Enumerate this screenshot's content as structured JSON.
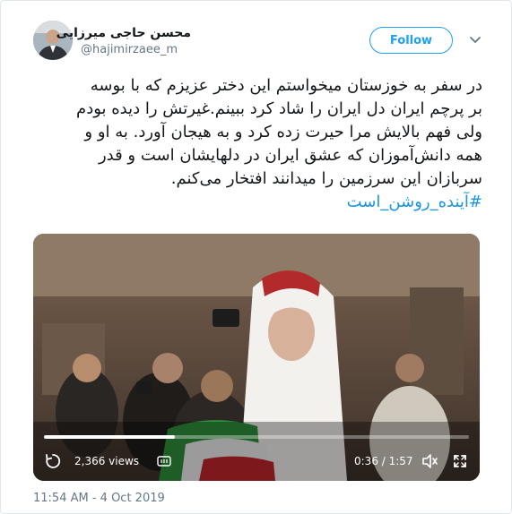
{
  "author": {
    "name": "محسن حاجی میرزایی",
    "handle": "@hajimirzaee_m",
    "avatar_icon": "avatar-photo"
  },
  "header": {
    "follow_label": "Follow",
    "menu_icon": "chevron-down-icon"
  },
  "tweet": {
    "lines": [
      "در سفر به خوزستان میخواستم این دختر عزیزم که با بوسه",
      "بر پرچم ایران دل ایران را شاد کرد ببینم.غیرتش را دیده بودم",
      "ولی فهم بالایش مرا حیرت زده کرد و به هیجان آورد. به او و",
      "همه دانش‌آموزان که عشق ایران در دلهایشان است و قدر",
      "سربازان این سرزمین را میدانند افتخار می‌کنم."
    ],
    "hashtag": "#آینده_روشن_است"
  },
  "video": {
    "views": "2,366 views",
    "current_time": "0:36 / 1:57",
    "progress": 0.3077,
    "controls": [
      "replay-icon",
      "gif-icon",
      "volume-icon",
      "fullscreen-icon"
    ]
  },
  "timestamp": "11:54 AM - 4 Oct 2019",
  "colors": {
    "accent": "#1da1f2",
    "link": "#1b95e0",
    "muted": "#657786"
  }
}
